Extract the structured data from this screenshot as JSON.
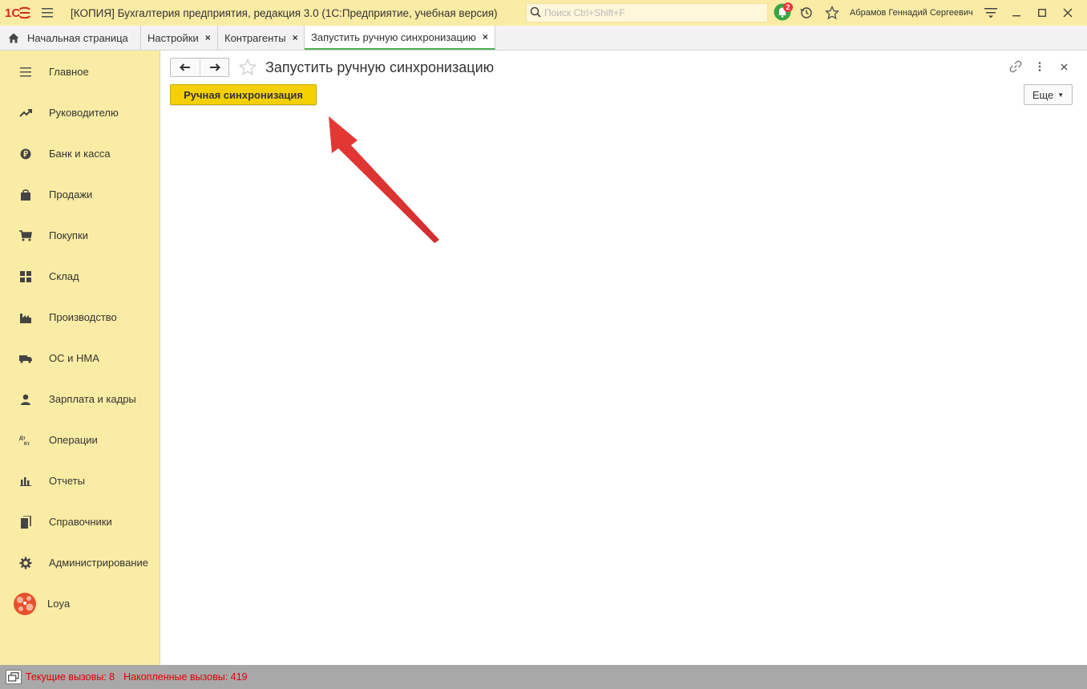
{
  "titlebar": {
    "app_title": "[КОПИЯ] Бухгалтерия предприятия, редакция 3.0  (1С:Предприятие, учебная версия)",
    "search_placeholder": "Поиск Ctrl+Shift+F",
    "notification_count": "2",
    "user_name": "Абрамов Геннадий Сергеевич",
    "icons": [
      "1c-logo-icon",
      "menu-icon",
      "search-icon",
      "bell-icon",
      "history-icon",
      "star-icon",
      "settings-lines-icon",
      "minimize-icon",
      "maximize-icon",
      "close-icon"
    ]
  },
  "tabs": [
    {
      "label": "Начальная страница",
      "icon": "home-icon",
      "closable": false,
      "active": false
    },
    {
      "label": "Настройки",
      "closable": true,
      "active": false
    },
    {
      "label": "Контрагенты",
      "closable": true,
      "active": false
    },
    {
      "label": "Запустить ручную синхронизацию",
      "closable": true,
      "active": true
    }
  ],
  "tab_close_glyph": "×",
  "sidebar": {
    "items": [
      {
        "label": "Главное",
        "icon": "menu-lines-icon"
      },
      {
        "label": "Руководителю",
        "icon": "trend-icon"
      },
      {
        "label": "Банк и касса",
        "icon": "ruble-icon"
      },
      {
        "label": "Продажи",
        "icon": "bag-icon"
      },
      {
        "label": "Покупки",
        "icon": "cart-icon"
      },
      {
        "label": "Склад",
        "icon": "warehouse-icon"
      },
      {
        "label": "Производство",
        "icon": "factory-icon"
      },
      {
        "label": "ОС и НМА",
        "icon": "truck-icon"
      },
      {
        "label": "Зарплата и кадры",
        "icon": "person-icon"
      },
      {
        "label": "Операции",
        "icon": "dt-kt-icon"
      },
      {
        "label": "Отчеты",
        "icon": "bar-chart-icon"
      },
      {
        "label": "Справочники",
        "icon": "books-icon"
      },
      {
        "label": "Администрирование",
        "icon": "gear-icon"
      },
      {
        "label": "Loya",
        "icon": "loya-logo-icon"
      }
    ]
  },
  "main": {
    "title": "Запустить ручную синхронизацию",
    "sync_button_label": "Ручная синхронизация",
    "more_button_label": "Еще",
    "dt_label": "Дт",
    "kt_label": "Кт"
  },
  "statusbar": {
    "current_calls": "Текущие вызовы: 8",
    "accumulated_calls": "Накопленные вызовы: 419"
  },
  "colors": {
    "titlebar_bg": "#fbeca5",
    "sidebar_bg": "#fbeca5",
    "accent_yellow": "#f5d000",
    "active_tab_underline": "#4caf50",
    "status_text": "#e00000",
    "annotation_arrow": "#e53935",
    "logo_red": "#d6281e"
  }
}
